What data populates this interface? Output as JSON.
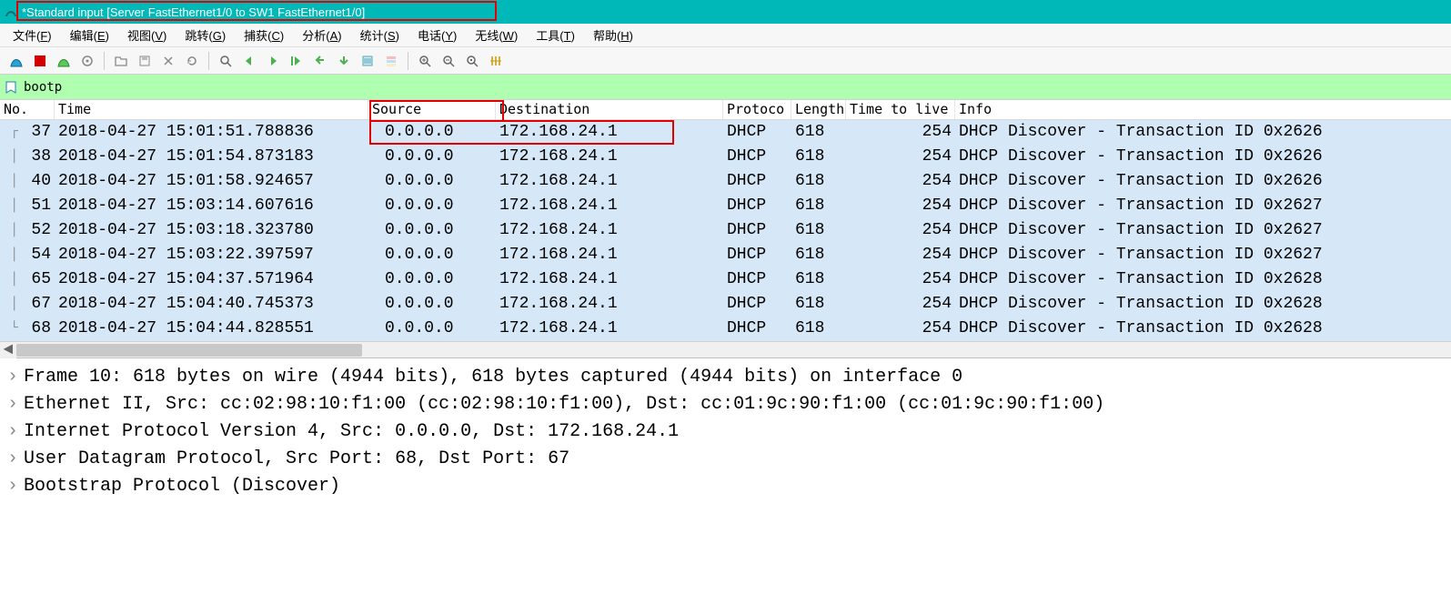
{
  "title": "*Standard input [Server FastEthernet1/0 to SW1 FastEthernet1/0]",
  "menu": [
    {
      "label": "文件",
      "k": "F"
    },
    {
      "label": "编辑",
      "k": "E"
    },
    {
      "label": "视图",
      "k": "V"
    },
    {
      "label": "跳转",
      "k": "G"
    },
    {
      "label": "捕获",
      "k": "C"
    },
    {
      "label": "分析",
      "k": "A"
    },
    {
      "label": "统计",
      "k": "S"
    },
    {
      "label": "电话",
      "k": "Y"
    },
    {
      "label": "无线",
      "k": "W"
    },
    {
      "label": "工具",
      "k": "T"
    },
    {
      "label": "帮助",
      "k": "H"
    }
  ],
  "filter": {
    "value": "bootp"
  },
  "columns": {
    "no": "No.",
    "time": "Time",
    "src": "Source",
    "dst": "Destination",
    "proto": "Protoco",
    "len": "Length",
    "ttl": "Time to live",
    "info": "Info"
  },
  "rows": [
    {
      "no": "37",
      "time": "2018-04-27 15:01:51.788836",
      "src": "0.0.0.0",
      "dst": "172.168.24.1",
      "proto": "DHCP",
      "len": "618",
      "ttl": "254",
      "info": "DHCP Discover - Transaction ID 0x2626"
    },
    {
      "no": "38",
      "time": "2018-04-27 15:01:54.873183",
      "src": "0.0.0.0",
      "dst": "172.168.24.1",
      "proto": "DHCP",
      "len": "618",
      "ttl": "254",
      "info": "DHCP Discover - Transaction ID 0x2626"
    },
    {
      "no": "40",
      "time": "2018-04-27 15:01:58.924657",
      "src": "0.0.0.0",
      "dst": "172.168.24.1",
      "proto": "DHCP",
      "len": "618",
      "ttl": "254",
      "info": "DHCP Discover - Transaction ID 0x2626"
    },
    {
      "no": "51",
      "time": "2018-04-27 15:03:14.607616",
      "src": "0.0.0.0",
      "dst": "172.168.24.1",
      "proto": "DHCP",
      "len": "618",
      "ttl": "254",
      "info": "DHCP Discover - Transaction ID 0x2627"
    },
    {
      "no": "52",
      "time": "2018-04-27 15:03:18.323780",
      "src": "0.0.0.0",
      "dst": "172.168.24.1",
      "proto": "DHCP",
      "len": "618",
      "ttl": "254",
      "info": "DHCP Discover - Transaction ID 0x2627"
    },
    {
      "no": "54",
      "time": "2018-04-27 15:03:22.397597",
      "src": "0.0.0.0",
      "dst": "172.168.24.1",
      "proto": "DHCP",
      "len": "618",
      "ttl": "254",
      "info": "DHCP Discover - Transaction ID 0x2627"
    },
    {
      "no": "65",
      "time": "2018-04-27 15:04:37.571964",
      "src": "0.0.0.0",
      "dst": "172.168.24.1",
      "proto": "DHCP",
      "len": "618",
      "ttl": "254",
      "info": "DHCP Discover - Transaction ID 0x2628"
    },
    {
      "no": "67",
      "time": "2018-04-27 15:04:40.745373",
      "src": "0.0.0.0",
      "dst": "172.168.24.1",
      "proto": "DHCP",
      "len": "618",
      "ttl": "254",
      "info": "DHCP Discover - Transaction ID 0x2628"
    },
    {
      "no": "68",
      "time": "2018-04-27 15:04:44.828551",
      "src": "0.0.0.0",
      "dst": "172.168.24.1",
      "proto": "DHCP",
      "len": "618",
      "ttl": "254",
      "info": "DHCP Discover - Transaction ID 0x2628"
    }
  ],
  "details": [
    "Frame 10: 618 bytes on wire (4944 bits), 618 bytes captured (4944 bits) on interface 0",
    "Ethernet II, Src: cc:02:98:10:f1:00 (cc:02:98:10:f1:00), Dst: cc:01:9c:90:f1:00 (cc:01:9c:90:f1:00)",
    "Internet Protocol Version 4, Src: 0.0.0.0, Dst: 172.168.24.1",
    "User Datagram Protocol, Src Port: 68, Dst Port: 67",
    "Bootstrap Protocol (Discover)"
  ]
}
